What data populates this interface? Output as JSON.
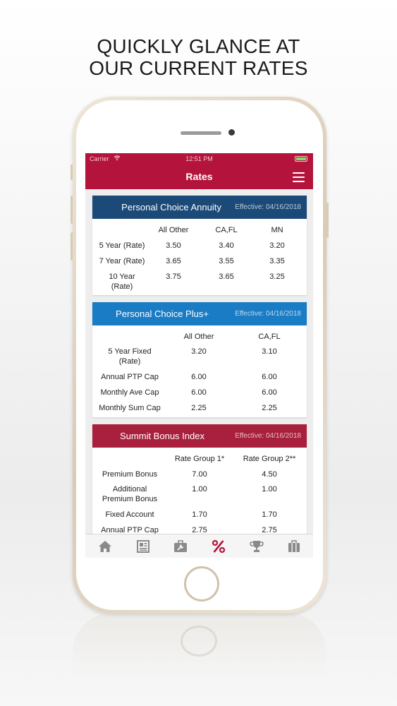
{
  "headline": {
    "line1": "QUICKLY GLANCE AT",
    "line2": "OUR CURRENT RATES"
  },
  "status_bar": {
    "carrier": "Carrier",
    "time": "12:51 PM"
  },
  "nav": {
    "title": "Rates"
  },
  "colors": {
    "brand_red": "#b4143c",
    "navy": "#1c4a78",
    "blue": "#1a7cc4",
    "crimson": "#a8203d",
    "active_tab": "#b4143c"
  },
  "cards": [
    {
      "title": "Personal Choice Annuity",
      "effective": "Effective: 04/16/2018",
      "columns": [
        "All Other",
        "CA,FL",
        "MN"
      ],
      "rows": [
        {
          "label": "5 Year (Rate)",
          "values": [
            "3.50",
            "3.40",
            "3.20"
          ]
        },
        {
          "label": "7 Year (Rate)",
          "values": [
            "3.65",
            "3.55",
            "3.35"
          ]
        },
        {
          "label": "10 Year (Rate)",
          "values": [
            "3.75",
            "3.65",
            "3.25"
          ]
        }
      ]
    },
    {
      "title": "Personal Choice Plus+",
      "effective": "Effective: 04/16/2018",
      "columns": [
        "All Other",
        "CA,FL"
      ],
      "rows": [
        {
          "label": "5 Year Fixed (Rate)",
          "values": [
            "3.20",
            "3.10"
          ]
        },
        {
          "label": "Annual PTP Cap",
          "values": [
            "6.00",
            "6.00"
          ]
        },
        {
          "label": "Monthly Ave Cap",
          "values": [
            "6.00",
            "6.00"
          ]
        },
        {
          "label": "Monthly Sum Cap",
          "values": [
            "2.25",
            "2.25"
          ]
        }
      ]
    },
    {
      "title": "Summit Bonus Index",
      "effective": "Effective: 04/16/2018",
      "columns": [
        "Rate Group 1*",
        "Rate Group 2**"
      ],
      "rows": [
        {
          "label": "Premium Bonus",
          "values": [
            "7.00",
            "4.50"
          ]
        },
        {
          "label": "Additional Premium Bonus",
          "values": [
            "1.00",
            "1.00"
          ]
        },
        {
          "label": "Fixed Account",
          "values": [
            "1.70",
            "1.70"
          ]
        },
        {
          "label": "Annual PTP Cap",
          "values": [
            "2.75",
            "2.75"
          ]
        }
      ]
    }
  ],
  "tabs": [
    {
      "icon": "home-icon",
      "active": false
    },
    {
      "icon": "document-icon",
      "active": false
    },
    {
      "icon": "toolkit-icon",
      "active": false
    },
    {
      "icon": "percent-icon",
      "active": true
    },
    {
      "icon": "trophy-icon",
      "active": false
    },
    {
      "icon": "briefcase-icon",
      "active": false
    }
  ]
}
